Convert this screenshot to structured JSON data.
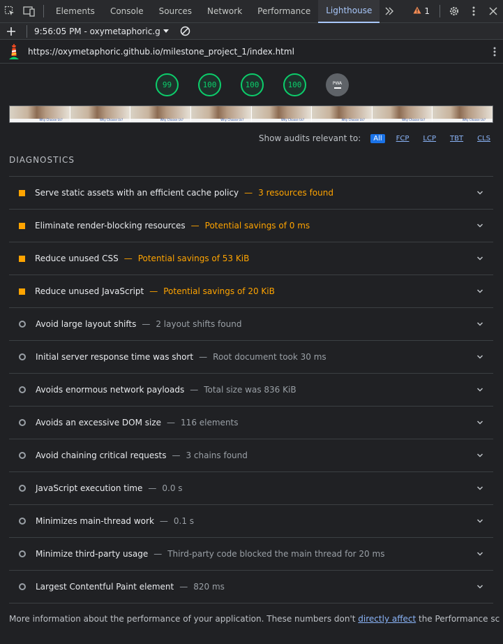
{
  "tabbar": {
    "tabs": [
      "Elements",
      "Console",
      "Sources",
      "Network",
      "Performance",
      "Lighthouse"
    ],
    "active_tab": "Lighthouse",
    "warning_count": "1",
    "icons": [
      "inspect-icon",
      "device-toolbar-icon",
      "more-tabs-icon",
      "warning-icon",
      "settings-icon",
      "kebab-menu-icon",
      "close-icon"
    ]
  },
  "toolbar": {
    "report_label": "9:56:05 PM - oxymetaphoric.g"
  },
  "urlbar": {
    "url": "https://oxymetaphoric.github.io/milestone_project_1/index.html"
  },
  "scores": [
    "99",
    "100",
    "100",
    "100"
  ],
  "pwa_label": "PWA",
  "filmstrip": {
    "caption": "Why Choose Us?",
    "frame_count": 8
  },
  "filter": {
    "label": "Show audits relevant to:",
    "options": [
      "All",
      "FCP",
      "LCP",
      "TBT",
      "CLS"
    ],
    "selected": "All"
  },
  "diagnostics": {
    "title": "DIAGNOSTICS",
    "dash": "—",
    "audits": [
      {
        "title": "Serve static assets with an efficient cache policy",
        "detail": "3 resources found",
        "severity": "warn"
      },
      {
        "title": "Eliminate render-blocking resources",
        "detail": "Potential savings of 0 ms",
        "severity": "warn"
      },
      {
        "title": "Reduce unused CSS",
        "detail": "Potential savings of 53 KiB",
        "severity": "warn"
      },
      {
        "title": "Reduce unused JavaScript",
        "detail": "Potential savings of 20 KiB",
        "severity": "warn"
      },
      {
        "title": "Avoid large layout shifts",
        "detail": "2 layout shifts found",
        "severity": "info"
      },
      {
        "title": "Initial server response time was short",
        "detail": "Root document took 30 ms",
        "severity": "info"
      },
      {
        "title": "Avoids enormous network payloads",
        "detail": "Total size was 836 KiB",
        "severity": "info"
      },
      {
        "title": "Avoids an excessive DOM size",
        "detail": "116 elements",
        "severity": "info"
      },
      {
        "title": "Avoid chaining critical requests",
        "detail": "3 chains found",
        "severity": "info"
      },
      {
        "title": "JavaScript execution time",
        "detail": "0.0 s",
        "severity": "info"
      },
      {
        "title": "Minimizes main-thread work",
        "detail": "0.1 s",
        "severity": "info"
      },
      {
        "title": "Minimize third-party usage",
        "detail": "Third-party code blocked the main thread for 20 ms",
        "severity": "info"
      },
      {
        "title": "Largest Contentful Paint element",
        "detail": "820 ms",
        "severity": "info"
      }
    ]
  },
  "footer": {
    "text_before": "More information about the performance of your application. These numbers don't ",
    "link": "directly affect",
    "text_after": " the Performance score."
  },
  "colors": {
    "pass": "#0cce6b",
    "warn": "#ffa400",
    "info": "#9aa0a6",
    "accent": "#a8c7fa"
  }
}
